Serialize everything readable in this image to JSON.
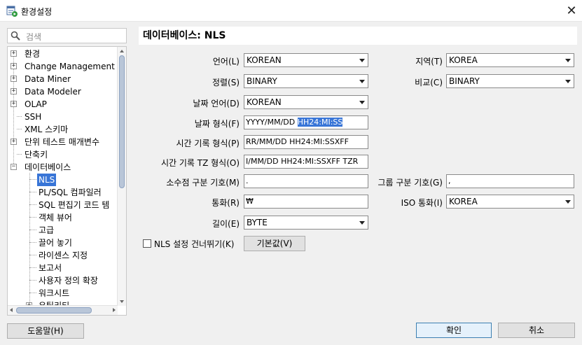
{
  "window": {
    "title": "환경설정",
    "close": "✕"
  },
  "search": {
    "placeholder": "검색"
  },
  "tree": {
    "items": [
      {
        "label": "환경",
        "expandable": true
      },
      {
        "label": "Change Management D",
        "expandable": true
      },
      {
        "label": "Data Miner",
        "expandable": true
      },
      {
        "label": "Data Modeler",
        "expandable": true
      },
      {
        "label": "OLAP",
        "expandable": true
      },
      {
        "label": "SSH",
        "expandable": false
      },
      {
        "label": "XML 스키마",
        "expandable": false
      },
      {
        "label": "단위 테스트 매개변수",
        "expandable": true
      },
      {
        "label": "단축키",
        "expandable": false
      },
      {
        "label": "데이터베이스",
        "expandable": true,
        "expanded": true
      },
      {
        "label": "NLS",
        "selected": true
      },
      {
        "label": "PL/SQL 컴파일러"
      },
      {
        "label": "SQL 편집기 코드 템"
      },
      {
        "label": "객체 뷰어"
      },
      {
        "label": "고급"
      },
      {
        "label": "끌어 놓기"
      },
      {
        "label": "라이센스 지정"
      },
      {
        "label": "보고서"
      },
      {
        "label": "사용자 정의 확장"
      },
      {
        "label": "워크시트"
      },
      {
        "label": "유틸리티"
      }
    ]
  },
  "panel": {
    "title": "데이터베이스: NLS",
    "language": {
      "label": "언어(L)",
      "value": "KOREAN"
    },
    "territory": {
      "label": "지역(T)",
      "value": "KOREA"
    },
    "sort": {
      "label": "정렬(S)",
      "value": "BINARY"
    },
    "comparison": {
      "label": "비교(C)",
      "value": "BINARY"
    },
    "date_language": {
      "label": "날짜 언어(D)",
      "value": "KOREAN"
    },
    "date_format": {
      "label": "날짜 형식(F)",
      "value_plain": "YYYY/MM/DD ",
      "value_selected": "HH24:MI:SS"
    },
    "timestamp_format": {
      "label": "시간 기록 형식(P)",
      "value": "RR/MM/DD HH24:MI:SSXFF"
    },
    "timestamp_tz_format": {
      "label": "시간 기록 TZ 형식(O)",
      "value": "I/MM/DD HH24:MI:SSXFF TZR"
    },
    "decimal_separator": {
      "label": "소수점 구분 기호(M)",
      "value": "."
    },
    "group_separator": {
      "label": "그룹 구분 기호(G)",
      "value": ","
    },
    "currency": {
      "label": "통화(R)",
      "value": "₩"
    },
    "iso_currency": {
      "label": "ISO 통화(I)",
      "value": "KOREA"
    },
    "length": {
      "label": "길이(E)",
      "value": "BYTE"
    },
    "skip_nls": {
      "label": "NLS 설정 건너뛰기(K)",
      "checked": false
    },
    "default_button": "기본값(V)"
  },
  "footer": {
    "help": "도움말(H)",
    "ok": "확인",
    "cancel": "취소"
  }
}
